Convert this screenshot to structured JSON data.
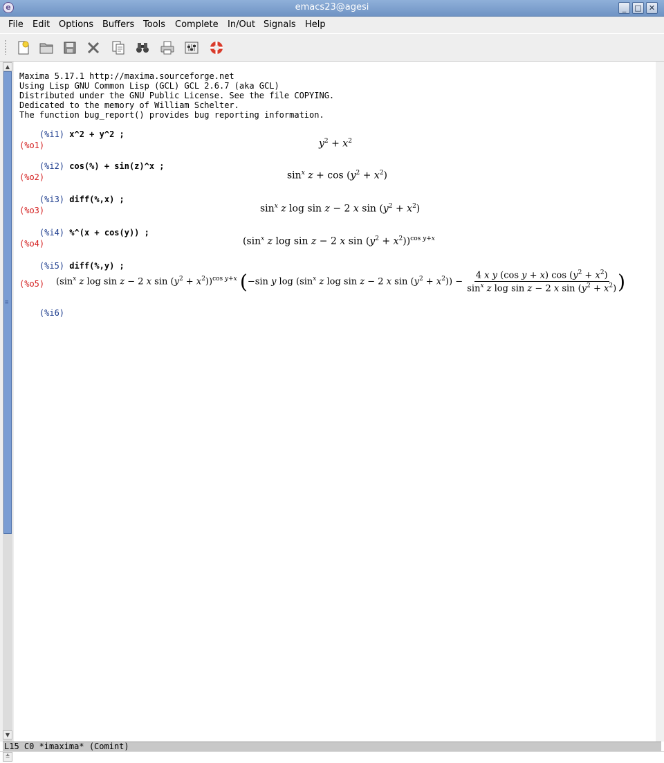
{
  "window": {
    "title": "emacs23@agesi"
  },
  "menu": [
    "File",
    "Edit",
    "Options",
    "Buffers",
    "Tools",
    "Complete",
    "In/Out",
    "Signals",
    "Help"
  ],
  "toolbar": [
    {
      "name": "new-file-icon"
    },
    {
      "name": "open-folder-icon"
    },
    {
      "name": "save-disk-icon"
    },
    {
      "name": "close-x-icon"
    },
    {
      "name": "copy-icon"
    },
    {
      "name": "search-binoculars-icon"
    },
    {
      "name": "print-icon"
    },
    {
      "name": "preferences-icon"
    },
    {
      "name": "help-lifebuoy-icon"
    }
  ],
  "banner": [
    "Maxima 5.17.1 http://maxima.sourceforge.net",
    "Using Lisp GNU Common Lisp (GCL) GCL 2.6.7 (aka GCL)",
    "Distributed under the GNU Public License. See the file COPYING.",
    "Dedicated to the memory of William Schelter.",
    "The function bug_report() provides bug reporting information."
  ],
  "session": {
    "i1": {
      "prompt": "(%i1)",
      "cmd": "x^2 + y^2 ;"
    },
    "o1": {
      "prompt": "(%o1)"
    },
    "i2": {
      "prompt": "(%i2)",
      "cmd": "cos(%) + sin(z)^x ;"
    },
    "o2": {
      "prompt": "(%o2)"
    },
    "i3": {
      "prompt": "(%i3)",
      "cmd": "diff(%,x) ;"
    },
    "o3": {
      "prompt": "(%o3)"
    },
    "i4": {
      "prompt": "(%i4)",
      "cmd": "%^(x + cos(y)) ;"
    },
    "o4": {
      "prompt": "(%o4)"
    },
    "i5": {
      "prompt": "(%i5)",
      "cmd": "diff(%,y) ;"
    },
    "o5": {
      "prompt": "(%o5)"
    },
    "i6": {
      "prompt": "(%i6)"
    }
  },
  "modeline": {
    "text": "L15 C0 *imaxima* (Comint)"
  },
  "colors": {
    "input_prompt": "#1a3a8c",
    "output_prompt": "#d42020",
    "scroll_thumb": "#7b9dd3"
  }
}
